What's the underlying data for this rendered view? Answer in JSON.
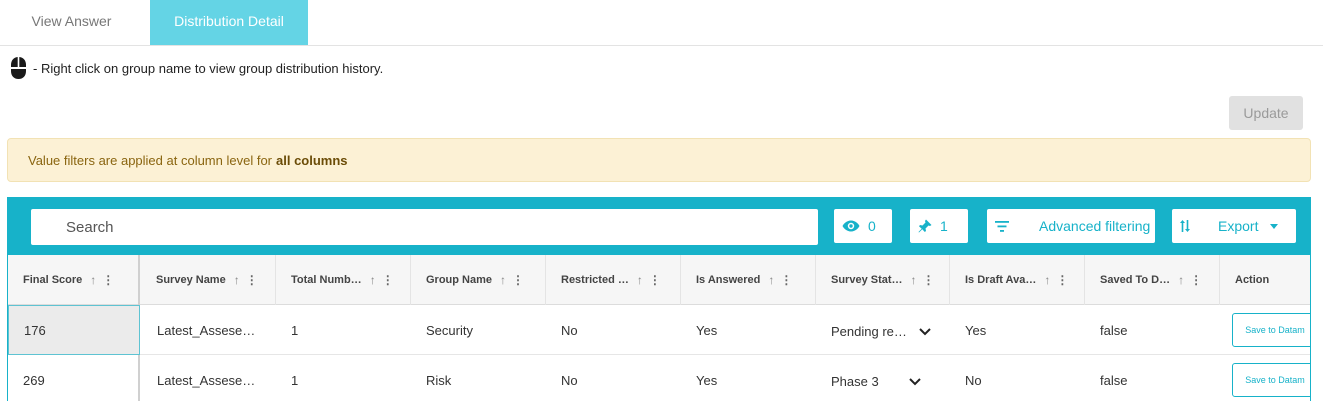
{
  "tabs": [
    {
      "label": "View Answer"
    },
    {
      "label": "Distribution Detail"
    }
  ],
  "hint": {
    "text": "- Right click on group name to view group distribution history."
  },
  "update_button": {
    "label": "Update"
  },
  "banner": {
    "text": "Value filters are applied at column level for",
    "bold": "all columns"
  },
  "toolbar": {
    "search_placeholder": "Search",
    "visible_count": "0",
    "pinned_count": "1",
    "advanced_label": "Advanced filtering",
    "export_label": "Export"
  },
  "columns": [
    "Final Score",
    "Survey Name",
    "Total Numb…",
    "Group Name",
    "Restricted …",
    "Is Answered",
    "Survey Stat…",
    "Is Draft Ava…",
    "Saved To D…",
    "Action"
  ],
  "rows": [
    {
      "final_score": "176",
      "survey_name": "Latest_Assese…",
      "total": "1",
      "group": "Security",
      "restricted": "No",
      "answered": "Yes",
      "status": "Pending re…",
      "draft": "Yes",
      "saved": "false",
      "action": "Save to Datam"
    },
    {
      "final_score": "269",
      "survey_name": "Latest_Assese…",
      "total": "1",
      "group": "Risk",
      "restricted": "No",
      "answered": "Yes",
      "status": "Phase 3",
      "draft": "No",
      "saved": "false",
      "action": "Save to Datam"
    }
  ],
  "colors": {
    "accent": "#17b2c9",
    "tab_active": "#64d4e5",
    "banner_bg": "#fcf1d5"
  }
}
